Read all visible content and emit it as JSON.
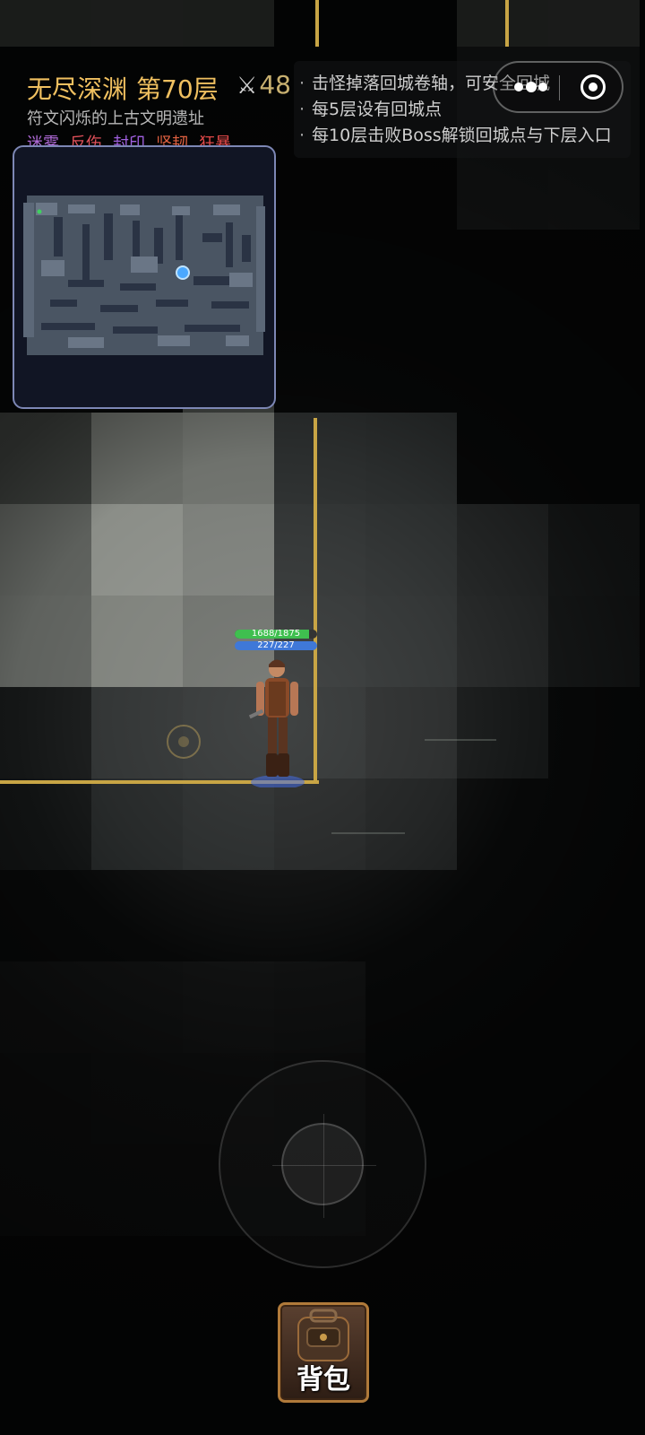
{
  "header": {
    "dungeon_name": "无尽深渊",
    "floor": "第70层",
    "combat_power": "48",
    "subtitle": "符文闪烁的上古文明遗址",
    "affixes": [
      {
        "label": "迷雾",
        "color": "#b06ad8"
      },
      {
        "label": "反伤",
        "color": "#e0505a"
      },
      {
        "label": "封印",
        "color": "#a060e0"
      },
      {
        "label": "坚韧",
        "color": "#e06040"
      },
      {
        "label": "狂暴",
        "color": "#e04848"
      }
    ]
  },
  "tips": [
    "击怪掉落回城卷轴，可安全回城",
    "每5层设有回城点",
    "每10层击败Boss解锁回城点与下层入口"
  ],
  "player": {
    "hp_text": "1688/1875",
    "hp_fraction": 0.9,
    "mp_text": "227/227",
    "mp_fraction": 1.0
  },
  "backpack": {
    "label": "背包"
  },
  "colors": {
    "title": "#f0c060",
    "wall_edge": "#c8a545",
    "hp": "#3fbf4f",
    "mp": "#3f78d8",
    "minimap_border": "#7d87b5"
  }
}
